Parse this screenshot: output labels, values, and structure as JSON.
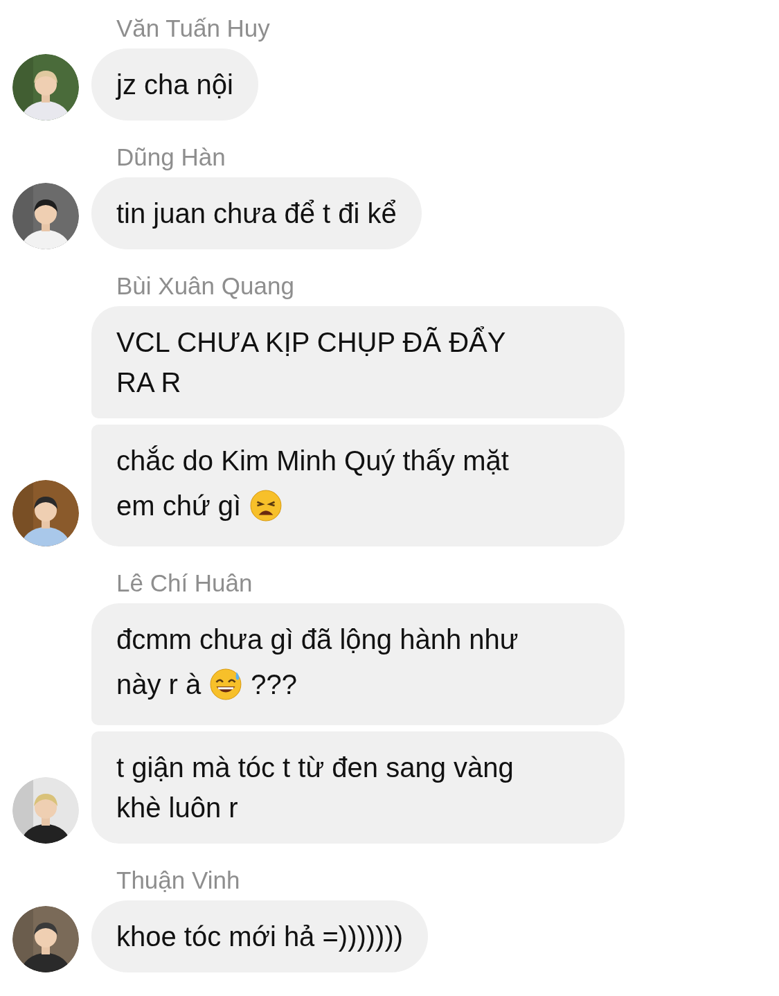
{
  "groups": [
    {
      "sender": "Văn Tuấn Huy",
      "avatar": {
        "kind": "picture"
      },
      "messages": [
        {
          "lines": [
            [
              {
                "kind": "text",
                "text": "jz cha nội"
              }
            ]
          ]
        }
      ]
    },
    {
      "sender": "Dũng Hàn",
      "avatar": {
        "kind": "picture"
      },
      "messages": [
        {
          "lines": [
            [
              {
                "kind": "text",
                "text": "tin juan chưa để t đi kể"
              }
            ]
          ]
        }
      ]
    },
    {
      "sender": "Bùi Xuân Quang",
      "avatar": {
        "kind": "picture"
      },
      "messages": [
        {
          "lines": [
            [
              {
                "kind": "text",
                "text": "VCL CHƯA KỊP CHỤP ĐÃ ĐẨY"
              }
            ],
            [
              {
                "kind": "text",
                "text": "RA R"
              }
            ]
          ]
        },
        {
          "lines": [
            [
              {
                "kind": "text",
                "text": "chắc do Kim Minh Quý thấy mặt"
              }
            ],
            [
              {
                "kind": "text",
                "text": "em chứ gì"
              },
              {
                "kind": "weary"
              }
            ]
          ]
        }
      ]
    },
    {
      "sender": "Lê Chí Huân",
      "avatar": {
        "kind": "picture"
      },
      "messages": [
        {
          "lines": [
            [
              {
                "kind": "text",
                "text": "đcmm chưa gì đã lộng hành như"
              }
            ],
            [
              {
                "kind": "text",
                "text": "này r à"
              },
              {
                "kind": "sweat"
              },
              {
                "kind": "text",
                "text": "???"
              }
            ]
          ]
        },
        {
          "lines": [
            [
              {
                "kind": "text",
                "text": "t giận mà tóc t từ đen sang vàng"
              }
            ],
            [
              {
                "kind": "text",
                "text": "khè luôn r"
              }
            ]
          ]
        }
      ]
    },
    {
      "sender": "Thuận Vinh",
      "avatar": {
        "kind": "picture"
      },
      "messages": [
        {
          "lines": [
            [
              {
                "kind": "text",
                "text": "khoe tóc mới hả =)))))))"
              }
            ]
          ]
        }
      ]
    }
  ]
}
